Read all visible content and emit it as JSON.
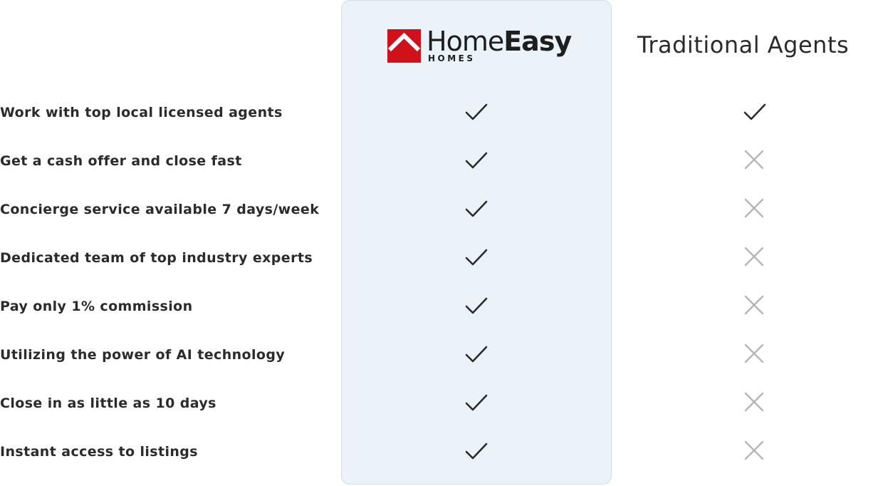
{
  "brand": {
    "name_light": "Home",
    "name_bold": "Easy",
    "sub": "HOMES",
    "brand_red": "#d0111b"
  },
  "header": {
    "competitor_title": "Traditional Agents"
  },
  "colors": {
    "homeeasy_bg": "#ebf3fa",
    "check": "#2b2b2b",
    "cross": "#b5b5b5"
  },
  "rows": [
    {
      "label": "Work with top local licensed agents",
      "homeeasy": "check-icon",
      "traditional": "check-icon"
    },
    {
      "label": "Get a cash offer and close fast",
      "homeeasy": "check-icon",
      "traditional": "cross-icon"
    },
    {
      "label": "Concierge service available 7 days/week",
      "homeeasy": "check-icon",
      "traditional": "cross-icon"
    },
    {
      "label": "Dedicated team of top industry experts",
      "homeeasy": "check-icon",
      "traditional": "cross-icon"
    },
    {
      "label": "Pay only 1% commission",
      "homeeasy": "check-icon",
      "traditional": "cross-icon"
    },
    {
      "label": "Utilizing the power of AI technology",
      "homeeasy": "check-icon",
      "traditional": "cross-icon"
    },
    {
      "label": "Close in as little as 10 days",
      "homeeasy": "check-icon",
      "traditional": "cross-icon"
    },
    {
      "label": "Instant access to listings",
      "homeeasy": "check-icon",
      "traditional": "cross-icon"
    }
  ]
}
